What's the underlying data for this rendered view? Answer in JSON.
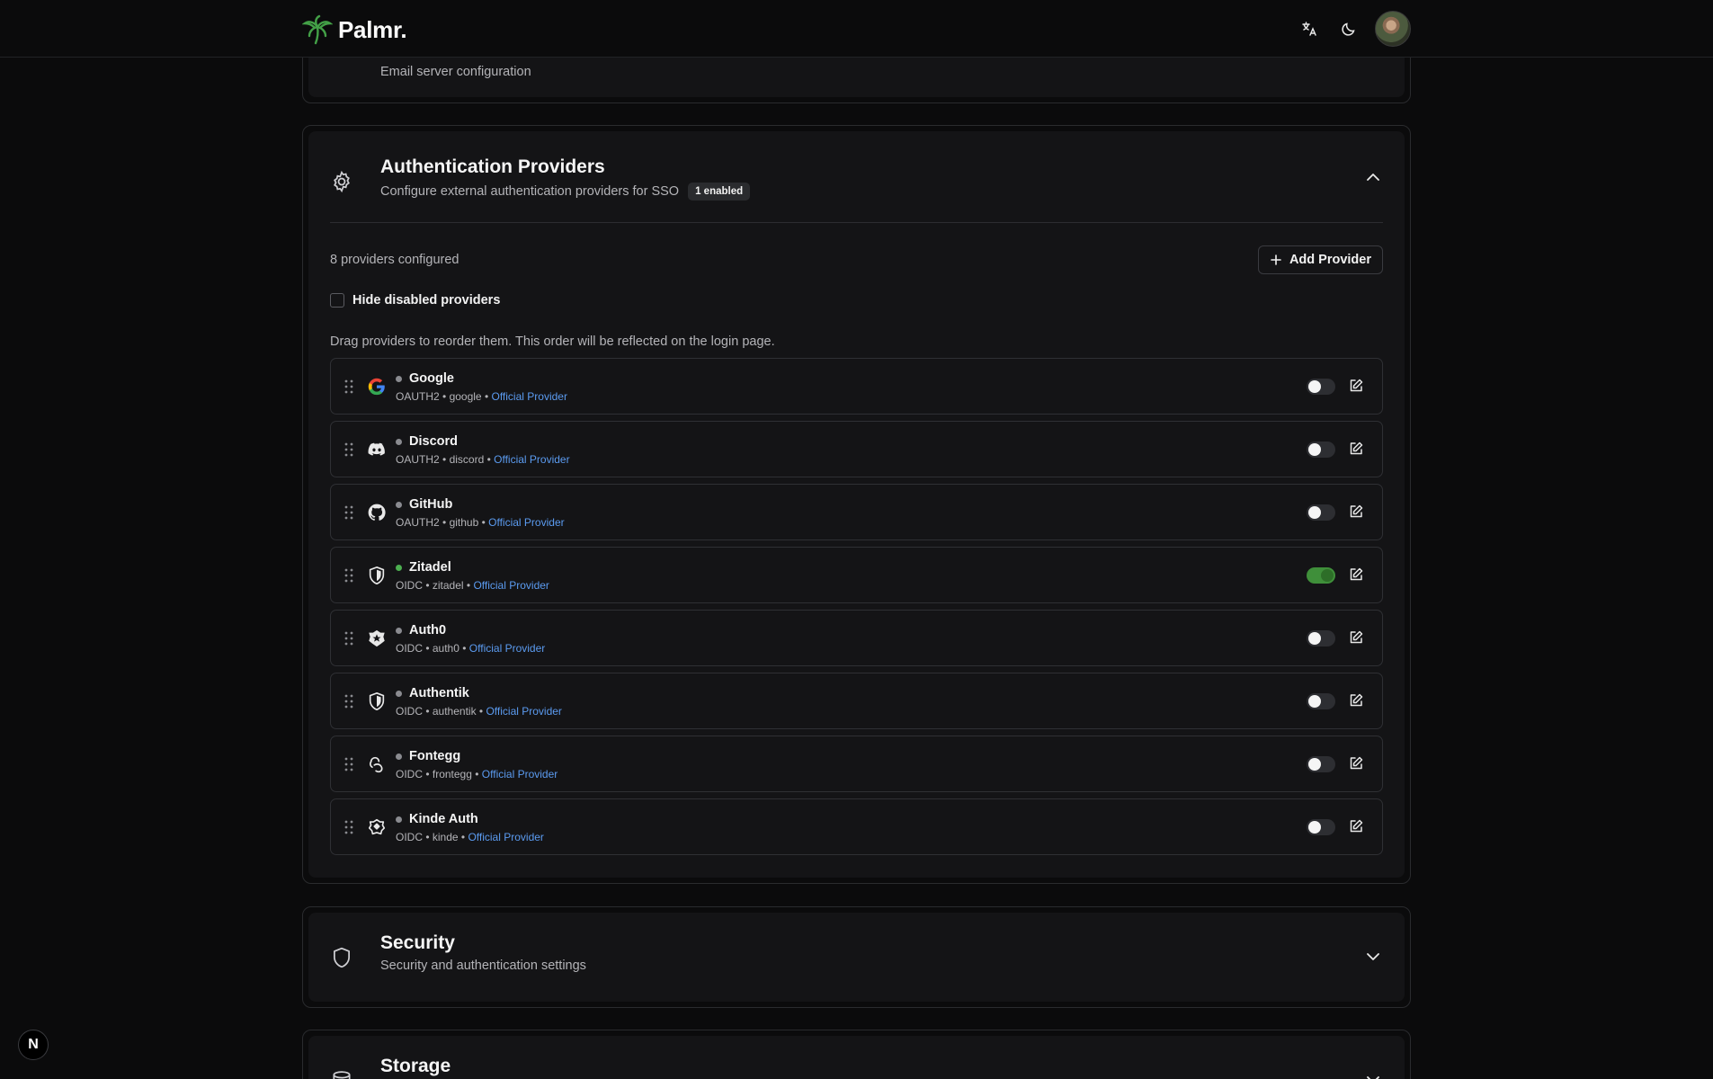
{
  "app": {
    "name": "Palmr."
  },
  "email_section": {
    "subtitle": "Email server configuration"
  },
  "auth_section": {
    "title": "Authentication Providers",
    "subtitle": "Configure external authentication providers for SSO",
    "badge": "1 enabled",
    "count_text": "8 providers configured",
    "add_button": "Add Provider",
    "hide_disabled_label": "Hide disabled providers",
    "hint": "Drag providers to reorder them. This order will be reflected on the login page.",
    "providers": [
      {
        "name": "Google",
        "type": "OAUTH2",
        "slug": "google",
        "tag": "Official Provider",
        "enabled": false,
        "icon": "google-icon"
      },
      {
        "name": "Discord",
        "type": "OAUTH2",
        "slug": "discord",
        "tag": "Official Provider",
        "enabled": false,
        "icon": "discord-icon"
      },
      {
        "name": "GitHub",
        "type": "OAUTH2",
        "slug": "github",
        "tag": "Official Provider",
        "enabled": false,
        "icon": "github-icon"
      },
      {
        "name": "Zitadel",
        "type": "OIDC",
        "slug": "zitadel",
        "tag": "Official Provider",
        "enabled": true,
        "icon": "shield-icon"
      },
      {
        "name": "Auth0",
        "type": "OIDC",
        "slug": "auth0",
        "tag": "Official Provider",
        "enabled": false,
        "icon": "auth0-icon"
      },
      {
        "name": "Authentik",
        "type": "OIDC",
        "slug": "authentik",
        "tag": "Official Provider",
        "enabled": false,
        "icon": "shield-icon"
      },
      {
        "name": "Fontegg",
        "type": "OIDC",
        "slug": "frontegg",
        "tag": "Official Provider",
        "enabled": false,
        "icon": "frontegg-icon"
      },
      {
        "name": "Kinde Auth",
        "type": "OIDC",
        "slug": "kinde",
        "tag": "Official Provider",
        "enabled": false,
        "icon": "kinde-icon"
      }
    ]
  },
  "security_section": {
    "title": "Security",
    "subtitle": "Security and authentication settings"
  },
  "storage_section": {
    "title": "Storage"
  },
  "dev_badge": "N",
  "colors": {
    "enabled_dot": "#4caf50",
    "link": "#5b9bf0",
    "toggle_on": "#3f8f3a"
  }
}
